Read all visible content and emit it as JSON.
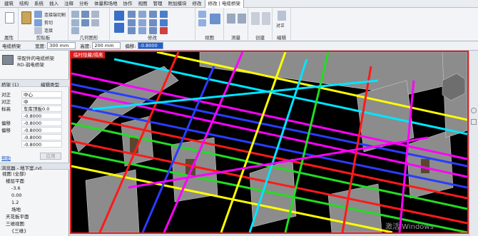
{
  "menu": [
    "建筑",
    "结构",
    "系统",
    "插入",
    "注释",
    "分析",
    "体量和场地",
    "协作",
    "视图",
    "管理",
    "附加模块",
    "修改",
    "修改 | 电缆桥架"
  ],
  "ribbon": {
    "groups": [
      "属性",
      "剪贴板",
      "几何图形",
      "修改",
      "视图",
      "测量",
      "创建",
      "编辑"
    ],
    "connect_label": "连接端切割",
    "cut_label": "剪切",
    "join_label": "连接",
    "align_label": "对正"
  },
  "options": {
    "context": "电缆桥架",
    "width_label": "宽度:",
    "width_value": "300 mm",
    "height_label": "高度:",
    "height_value": "200 mm",
    "offset_label": "偏移:",
    "offset_value": "-0.8000 m"
  },
  "properties": {
    "type_line1": "带配件的电缆桥架",
    "type_line2": "RD-弱电桥架",
    "instance_label": "桥架 (1)",
    "edit_type_label": "编辑类型",
    "rows": [
      {
        "k": "对正",
        "v": "中心"
      },
      {
        "k": "对正",
        "v": "中"
      },
      {
        "k": "标高",
        "v": "车库顶板0.0"
      },
      {
        "k": "",
        "v": "-0.8000"
      },
      {
        "k": "偏移",
        "v": "-0.8000"
      },
      {
        "k": "偏移",
        "v": "-0.8000"
      },
      {
        "k": "",
        "v": "-0.8000"
      },
      {
        "k": "",
        "v": "-0.8000"
      }
    ],
    "help_link": "帮助",
    "apply_label": "应用"
  },
  "browser": {
    "title": "浏览器 - 地下室.rvt",
    "items": [
      "视图 (全部)",
      "楼层平面",
      "-3.6",
      "0.00",
      "1.2",
      "场地",
      "天花板平面",
      "三维视图",
      "{三维}"
    ]
  },
  "viewport": {
    "tab": "临时隐藏/隔离",
    "watermark": "激活 Windows"
  },
  "colors": {
    "accent": "#1e5fd0",
    "viewport_border": "#e02020",
    "magenta": "#ff00ff",
    "yellow": "#ffff00",
    "red": "#ff1a1a",
    "cyan": "#00e5ff",
    "green": "#22dd22",
    "blue": "#2a3cff"
  }
}
